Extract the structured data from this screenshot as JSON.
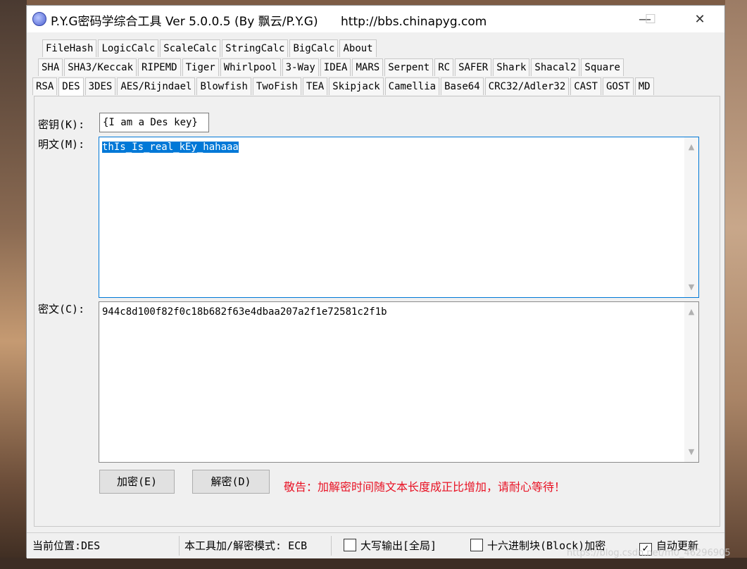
{
  "window": {
    "title": "P.Y.G密码学综合工具 Ver 5.0.0.5 (By 飘云/P.Y.G)      http://bbs.chinapyg.com",
    "minimize": "—",
    "maximize": "☐",
    "close": "✕"
  },
  "tabs": {
    "row1": [
      "FileHash",
      "LogicCalc",
      "ScaleCalc",
      "StringCalc",
      "BigCalc",
      "About"
    ],
    "row2": [
      "SHA",
      "SHA3/Keccak",
      "RIPEMD",
      "Tiger",
      "Whirlpool",
      "3-Way",
      "IDEA",
      "MARS",
      "Serpent",
      "RC",
      "SAFER",
      "Shark",
      "Shacal2",
      "Square"
    ],
    "row3": [
      "RSA",
      "DES",
      "3DES",
      "AES/Rijndael",
      "Blowfish",
      "TwoFish",
      "TEA",
      "Skipjack",
      "Camellia",
      "Base64",
      "CRC32/Adler32",
      "CAST",
      "GOST",
      "MD"
    ],
    "active": "DES"
  },
  "form": {
    "key_label": "密钥(K):",
    "key_value": "{I am a Des key}",
    "plain_label": "明文(M):",
    "plain_value": "thIs_Is_real_kEy_hahaaa",
    "cipher_label": "密文(C):",
    "cipher_value": "944c8d100f82f0c18b682f63e4dbaa207a2f1e72581c2f1b"
  },
  "buttons": {
    "encrypt": "加密(E)",
    "decrypt": "解密(D)"
  },
  "warning": "敬告：加解密时间随文本长度成正比增加，请耐心等待！",
  "status": {
    "position": "当前位置:DES",
    "mode": "本工具加/解密模式: ECB",
    "uppercase": "大写输出[全局]",
    "hexblock": "十六进制块(Block)加密",
    "autoupdate": "自动更新",
    "uppercase_checked": false,
    "hexblock_checked": false,
    "autoupdate_checked": true
  },
  "watermark": "https://blog.csdn.net/m0_46296905",
  "colors": {
    "warning": "#e81123",
    "selection": "#0078d7"
  }
}
